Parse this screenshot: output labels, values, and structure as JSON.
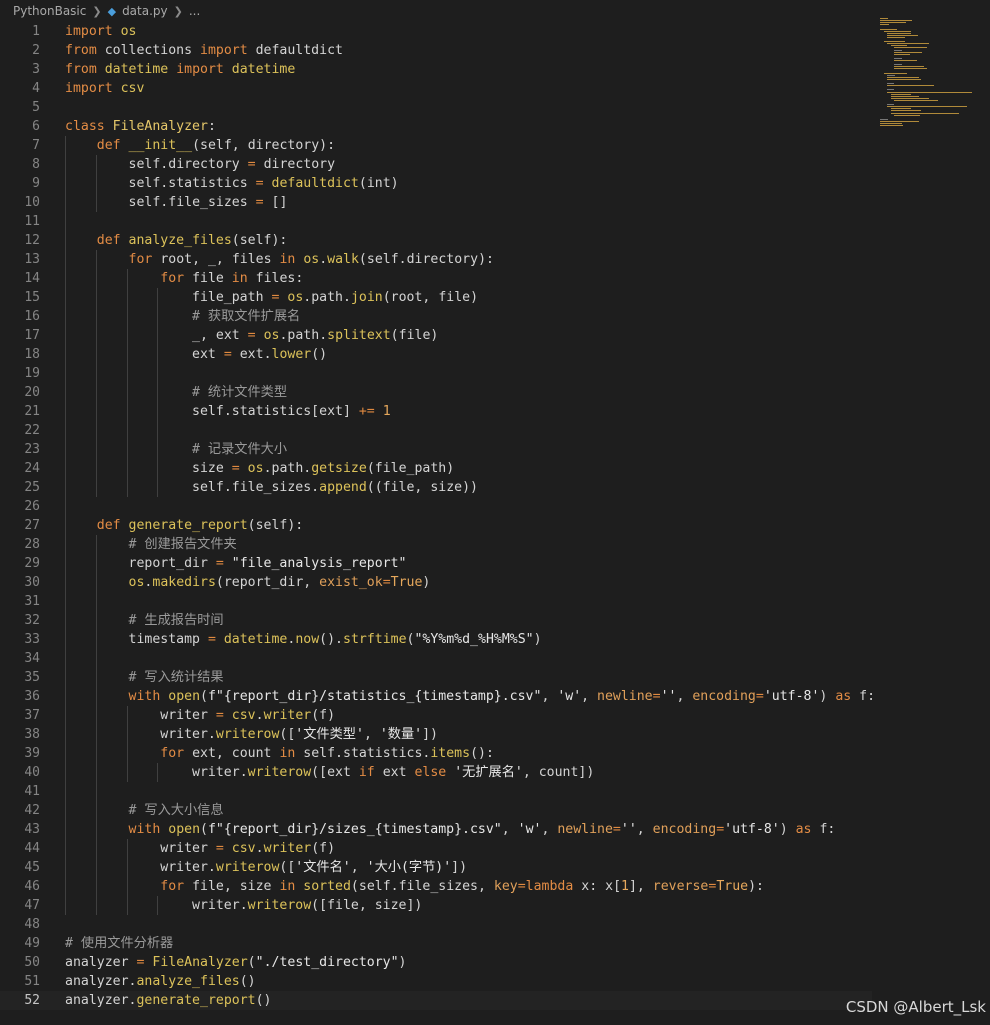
{
  "breadcrumb": {
    "folder": "PythonBasic",
    "file": "data.py",
    "ellipsis": "..."
  },
  "editor": {
    "current_line": 52,
    "lines": [
      {
        "n": 1,
        "indent": 0,
        "code": "import os"
      },
      {
        "n": 2,
        "indent": 0,
        "code": "from collections import defaultdict"
      },
      {
        "n": 3,
        "indent": 0,
        "code": "from datetime import datetime"
      },
      {
        "n": 4,
        "indent": 0,
        "code": "import csv"
      },
      {
        "n": 5,
        "indent": 0,
        "code": ""
      },
      {
        "n": 6,
        "indent": 0,
        "code": "class FileAnalyzer:"
      },
      {
        "n": 7,
        "indent": 1,
        "code": "    def __init__(self, directory):"
      },
      {
        "n": 8,
        "indent": 2,
        "code": "        self.directory = directory"
      },
      {
        "n": 9,
        "indent": 2,
        "code": "        self.statistics = defaultdict(int)"
      },
      {
        "n": 10,
        "indent": 2,
        "code": "        self.file_sizes = []"
      },
      {
        "n": 11,
        "indent": 1,
        "code": ""
      },
      {
        "n": 12,
        "indent": 1,
        "code": "    def analyze_files(self):"
      },
      {
        "n": 13,
        "indent": 2,
        "code": "        for root, _, files in os.walk(self.directory):"
      },
      {
        "n": 14,
        "indent": 3,
        "code": "            for file in files:"
      },
      {
        "n": 15,
        "indent": 4,
        "code": "                file_path = os.path.join(root, file)"
      },
      {
        "n": 16,
        "indent": 4,
        "code": "                # 获取文件扩展名"
      },
      {
        "n": 17,
        "indent": 4,
        "code": "                _, ext = os.path.splitext(file)"
      },
      {
        "n": 18,
        "indent": 4,
        "code": "                ext = ext.lower()"
      },
      {
        "n": 19,
        "indent": 4,
        "code": ""
      },
      {
        "n": 20,
        "indent": 4,
        "code": "                # 统计文件类型"
      },
      {
        "n": 21,
        "indent": 4,
        "code": "                self.statistics[ext] += 1"
      },
      {
        "n": 22,
        "indent": 4,
        "code": ""
      },
      {
        "n": 23,
        "indent": 4,
        "code": "                # 记录文件大小"
      },
      {
        "n": 24,
        "indent": 4,
        "code": "                size = os.path.getsize(file_path)"
      },
      {
        "n": 25,
        "indent": 4,
        "code": "                self.file_sizes.append((file, size))"
      },
      {
        "n": 26,
        "indent": 1,
        "code": ""
      },
      {
        "n": 27,
        "indent": 1,
        "code": "    def generate_report(self):"
      },
      {
        "n": 28,
        "indent": 2,
        "code": "        # 创建报告文件夹"
      },
      {
        "n": 29,
        "indent": 2,
        "code": "        report_dir = \"file_analysis_report\""
      },
      {
        "n": 30,
        "indent": 2,
        "code": "        os.makedirs(report_dir, exist_ok=True)"
      },
      {
        "n": 31,
        "indent": 2,
        "code": ""
      },
      {
        "n": 32,
        "indent": 2,
        "code": "        # 生成报告时间"
      },
      {
        "n": 33,
        "indent": 2,
        "code": "        timestamp = datetime.now().strftime(\"%Y%m%d_%H%M%S\")"
      },
      {
        "n": 34,
        "indent": 2,
        "code": ""
      },
      {
        "n": 35,
        "indent": 2,
        "code": "        # 写入统计结果"
      },
      {
        "n": 36,
        "indent": 2,
        "code": "        with open(f\"{report_dir}/statistics_{timestamp}.csv\", 'w', newline='', encoding='utf-8') as f:"
      },
      {
        "n": 37,
        "indent": 3,
        "code": "            writer = csv.writer(f)"
      },
      {
        "n": 38,
        "indent": 3,
        "code": "            writer.writerow(['文件类型', '数量'])"
      },
      {
        "n": 39,
        "indent": 3,
        "code": "            for ext, count in self.statistics.items():"
      },
      {
        "n": 40,
        "indent": 4,
        "code": "                writer.writerow([ext if ext else '无扩展名', count])"
      },
      {
        "n": 41,
        "indent": 2,
        "code": ""
      },
      {
        "n": 42,
        "indent": 2,
        "code": "        # 写入大小信息"
      },
      {
        "n": 43,
        "indent": 2,
        "code": "        with open(f\"{report_dir}/sizes_{timestamp}.csv\", 'w', newline='', encoding='utf-8') as f:"
      },
      {
        "n": 44,
        "indent": 3,
        "code": "            writer = csv.writer(f)"
      },
      {
        "n": 45,
        "indent": 3,
        "code": "            writer.writerow(['文件名', '大小(字节)'])"
      },
      {
        "n": 46,
        "indent": 3,
        "code": "            for file, size in sorted(self.file_sizes, key=lambda x: x[1], reverse=True):"
      },
      {
        "n": 47,
        "indent": 4,
        "code": "                writer.writerow([file, size])"
      },
      {
        "n": 48,
        "indent": 0,
        "code": ""
      },
      {
        "n": 49,
        "indent": 0,
        "code": "# 使用文件分析器"
      },
      {
        "n": 50,
        "indent": 0,
        "code": "analyzer = FileAnalyzer(\"./test_directory\")"
      },
      {
        "n": 51,
        "indent": 0,
        "code": "analyzer.analyze_files()"
      },
      {
        "n": 52,
        "indent": 0,
        "code": "analyzer.generate_report()"
      }
    ]
  },
  "watermark": "CSDN @Albert_Lsk"
}
